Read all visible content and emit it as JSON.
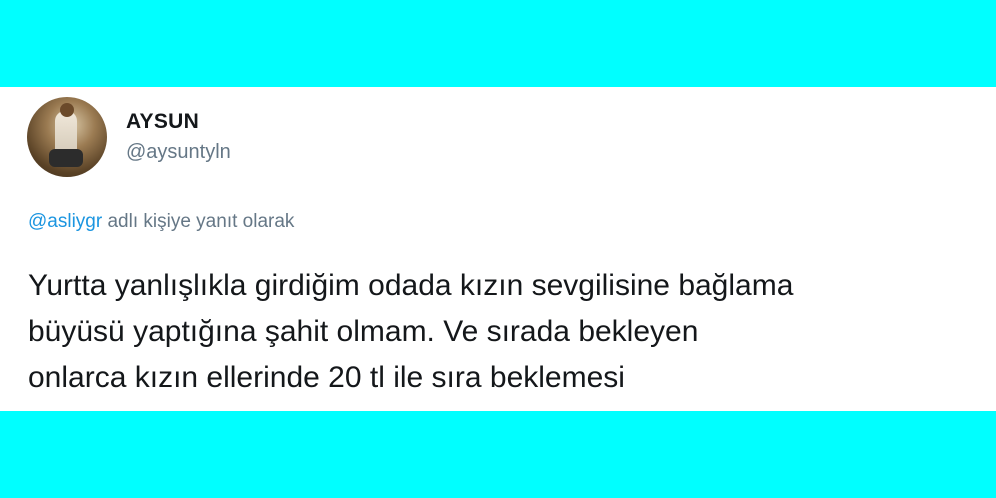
{
  "tweet": {
    "author_name": "AYSUN",
    "author_handle": "@aysuntyln",
    "reply_mention": "@asliygr",
    "reply_suffix": "adlı kişiye yanıt olarak",
    "text_lines": [
      "Yurtta yanlışlıkla girdiğim odada kızın sevgilisine bağlama",
      "büyüsü yaptığına şahit olmam. Ve sırada bekleyen",
      "onlarca kızın ellerinde 20 tl ile sıra beklemesi"
    ]
  },
  "colors": {
    "background": "#00FFFF",
    "card": "#FFFFFF",
    "text": "#14171A",
    "muted": "#657786",
    "link": "#1B95E0"
  }
}
